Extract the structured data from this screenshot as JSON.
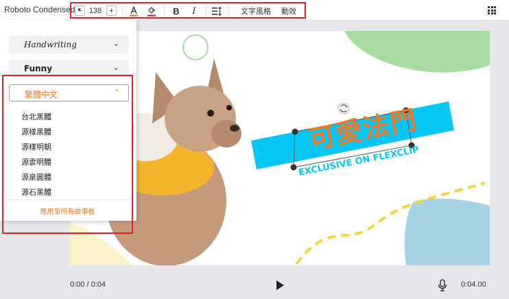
{
  "toolbar": {
    "font_name": "Roboto Condensed",
    "minus": "−",
    "size": "138",
    "plus": "+",
    "bold": "B",
    "italic": "I",
    "text_style": "文字風格",
    "animation": "動效"
  },
  "sidebar": {
    "categories": [
      {
        "label": "Handwriting"
      },
      {
        "label": "Funny"
      }
    ],
    "active_category": "繁體中文",
    "fonts": [
      "台北黑體",
      "源樣黑體",
      "源樣明朝",
      "源雲明體",
      "源泉圓體",
      "源石黑體"
    ],
    "apply_all": "應用至所有故事板"
  },
  "slide": {
    "title": "可愛法門",
    "subtitle": "EXCLUSIVE ON FLEXCLIP"
  },
  "player": {
    "current_time": "0:00 / 0:04",
    "end_time": "0:04.00"
  },
  "colors": {
    "accent": "#ea7a2a",
    "highlight_red": "#d9252a",
    "banner_blue": "#05c6f5",
    "green_blob": "#a6dca0",
    "blue_blob": "#a6d3e3",
    "yellow_dash": "#f5d53c"
  }
}
